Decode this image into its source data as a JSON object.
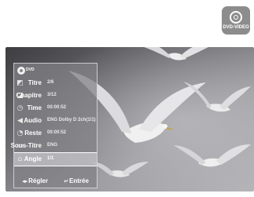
{
  "badge": {
    "icon": "disc-icon",
    "label": "DVD-VIDEO"
  },
  "osd": {
    "logo_text": "DVD",
    "rows": [
      {
        "icon": "title-icon",
        "label": "Titre",
        "value": "2/6"
      },
      {
        "icon": "chapter-icon",
        "label": "Chapitre",
        "value": "3/12"
      },
      {
        "icon": "clock-icon",
        "label": "Time",
        "value": "00:00:52"
      },
      {
        "icon": "speaker-icon",
        "label": "Audio",
        "value": "ENG Dolby D 2ch(1/1)"
      },
      {
        "icon": "remaining-icon",
        "label": "Reste",
        "value": "00:00:52"
      },
      {
        "icon": "subtitle-icon",
        "label": "Sous-Titre",
        "value": "ENG"
      },
      {
        "icon": "camera-angle-icon",
        "label": "Angle",
        "value": "1/1"
      }
    ],
    "selected_index": 6,
    "footer": {
      "adjust_glyph": "◂▸",
      "adjust_label": "Régler",
      "enter_glyph": "↵",
      "enter_label": "Entrée"
    }
  }
}
